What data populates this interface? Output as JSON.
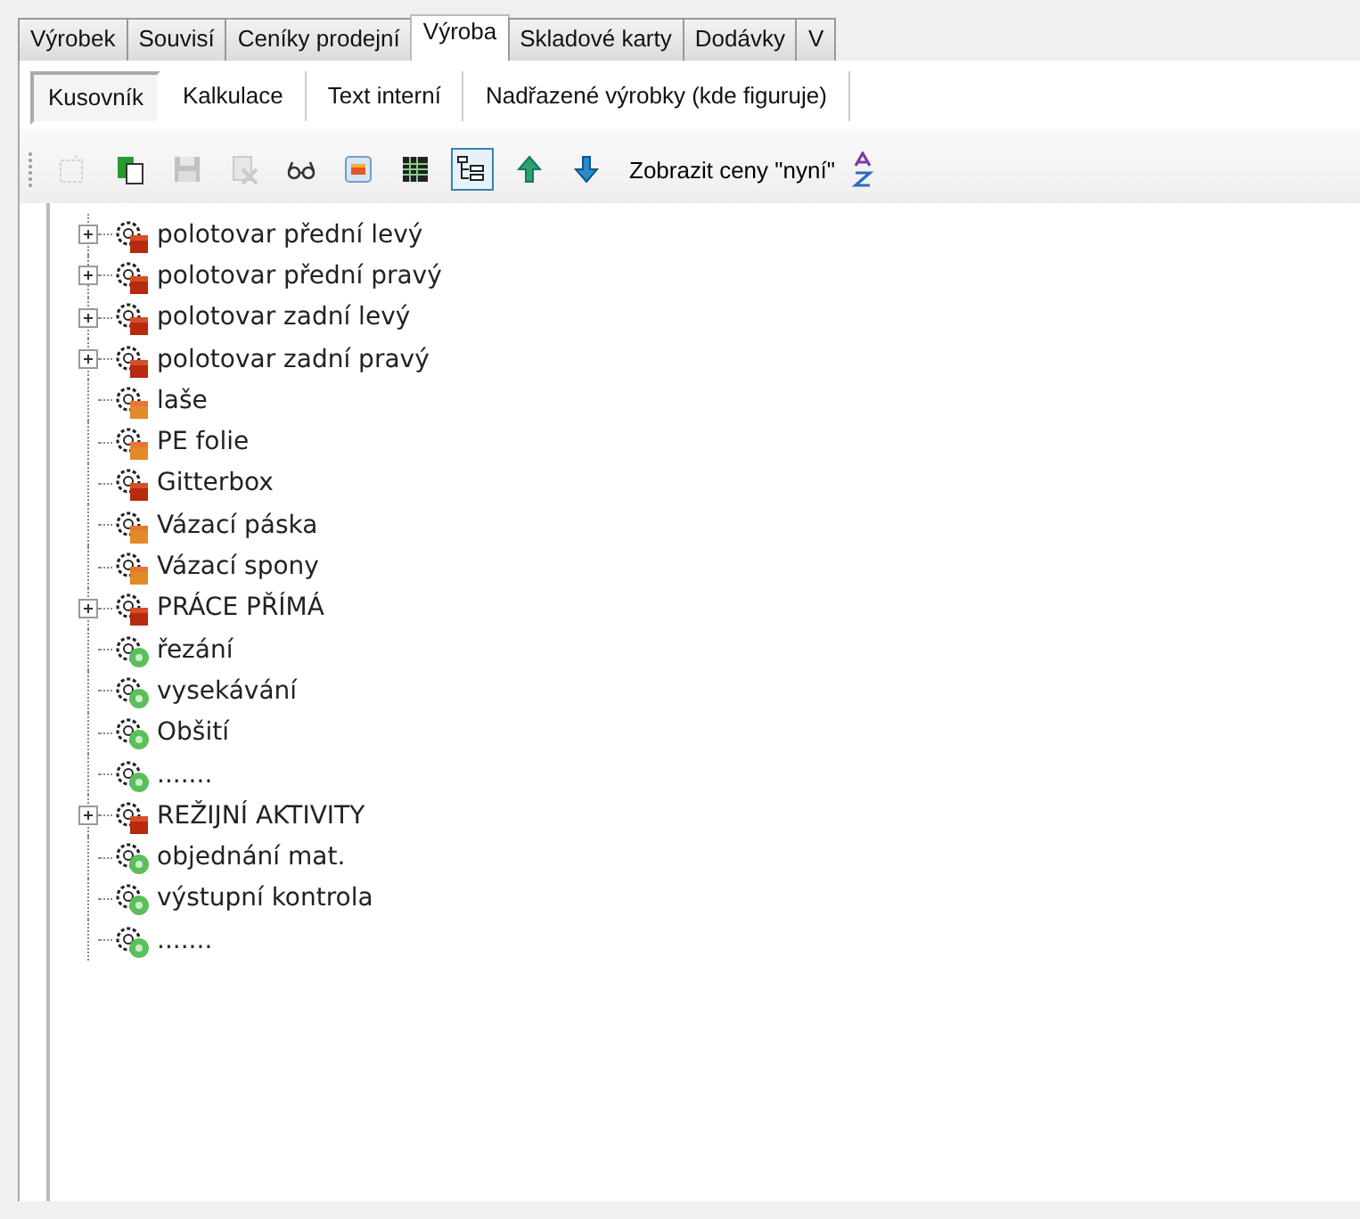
{
  "tabs": [
    {
      "label": "Výrobek",
      "selected": false
    },
    {
      "label": "Souvisí",
      "selected": false
    },
    {
      "label": "Ceníky prodejní",
      "selected": false
    },
    {
      "label": "Výroba",
      "selected": true
    },
    {
      "label": "Skladové karty",
      "selected": false
    },
    {
      "label": "Dodávky",
      "selected": false
    },
    {
      "label": "V",
      "selected": false
    }
  ],
  "subtabs": [
    {
      "label": "Kusovník",
      "selected": true
    },
    {
      "label": "Kalkulace",
      "selected": false
    },
    {
      "label": "Text interní",
      "selected": false
    },
    {
      "label": "Nadřazené výrobky (kde figuruje)",
      "selected": false
    }
  ],
  "toolbar": {
    "buttons": [
      {
        "kind": "new",
        "disabled": true,
        "selected": false
      },
      {
        "kind": "copy",
        "disabled": false,
        "selected": false
      },
      {
        "kind": "save",
        "disabled": true,
        "selected": false
      },
      {
        "kind": "delete",
        "disabled": true,
        "selected": false
      },
      {
        "kind": "glasses",
        "disabled": false,
        "selected": false
      },
      {
        "kind": "report",
        "disabled": false,
        "selected": false
      },
      {
        "kind": "grid",
        "disabled": false,
        "selected": false
      },
      {
        "kind": "tree",
        "disabled": false,
        "selected": true
      },
      {
        "kind": "up",
        "disabled": false,
        "selected": false
      },
      {
        "kind": "down",
        "disabled": false,
        "selected": false
      }
    ],
    "text_button": "Zobrazit ceny \"nyní\"",
    "end_icon": {
      "kind": "sort"
    }
  },
  "tree": [
    {
      "label": "polotovar přední levý",
      "kind": "semi-product",
      "expandable": true
    },
    {
      "label": "polotovar přední pravý",
      "kind": "semi-product",
      "expandable": true
    },
    {
      "label": "polotovar zadní levý",
      "kind": "semi-product",
      "expandable": true
    },
    {
      "label": "polotovar zadní pravý",
      "kind": "semi-product",
      "expandable": true
    },
    {
      "label": "laše",
      "kind": "material",
      "expandable": false
    },
    {
      "label": "PE folie",
      "kind": "material",
      "expandable": false
    },
    {
      "label": "Gitterbox",
      "kind": "semi-product",
      "expandable": false
    },
    {
      "label": "Vázací páska",
      "kind": "material",
      "expandable": false
    },
    {
      "label": "Vázací spony",
      "kind": "material",
      "expandable": false
    },
    {
      "label": "PRÁCE PŘÍMÁ",
      "kind": "semi-product",
      "expandable": true
    },
    {
      "label": "řezání",
      "kind": "operation",
      "expandable": false
    },
    {
      "label": "vysekávání",
      "kind": "operation",
      "expandable": false
    },
    {
      "label": "Obšití",
      "kind": "operation",
      "expandable": false
    },
    {
      "label": ".......",
      "kind": "operation",
      "expandable": false
    },
    {
      "label": "REŽIJNÍ AKTIVITY",
      "kind": "semi-product",
      "expandable": true
    },
    {
      "label": "objednání mat.",
      "kind": "operation",
      "expandable": false
    },
    {
      "label": "výstupní kontrola",
      "kind": "operation",
      "expandable": false
    },
    {
      "label": ".......",
      "kind": "operation",
      "expandable": false
    }
  ]
}
